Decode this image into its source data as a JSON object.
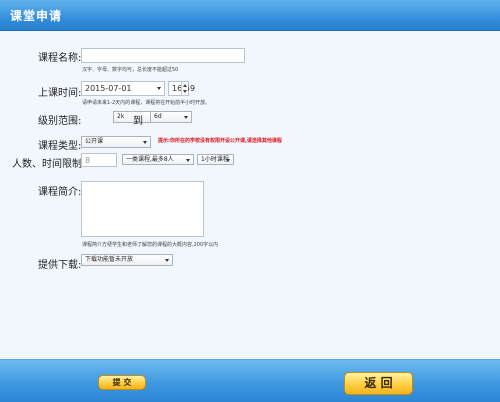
{
  "title": "课堂申请",
  "form": {
    "course_name": {
      "label": "课程名称:",
      "value": "",
      "hint": "汉字、字母、数字均可，总长度不能超过50"
    },
    "class_time": {
      "label": "上课时间:",
      "date": "2015-07-01",
      "time": "16:59",
      "hint": "请申请未来1-2天内的课程，课程将在开始前半小时开放。"
    },
    "grade_range": {
      "label": "级别范围:",
      "from": "2k",
      "sep": "到",
      "to": "6d"
    },
    "course_type": {
      "label": "课程类型:",
      "value": "公开课",
      "warning": "提示:你所在的学校没有权限开设公开课,请选择其他课程"
    },
    "capacity": {
      "label": "人数、时间限制:",
      "count": "8",
      "type_select": "一类课程,最多8人",
      "duration_select": "1小时课程"
    },
    "intro": {
      "label": "课程简介:",
      "value": "",
      "hint": "课程简介方便学生和老师了解您的课程的大概内容,200字以内"
    },
    "download": {
      "label": "提供下载:",
      "value": "下载功能暂未开放"
    }
  },
  "buttons": {
    "submit": "提 交",
    "back": "返 回"
  }
}
